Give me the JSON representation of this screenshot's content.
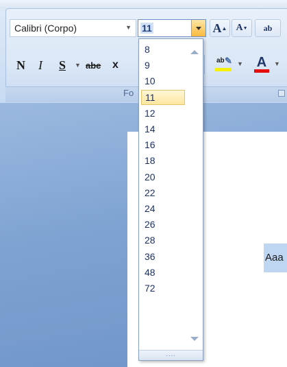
{
  "ribbon": {
    "font_name": "Calibri (Corpo)",
    "font_size": "11",
    "grow_font_label": "A",
    "shrink_font_label": "A",
    "clear_format_label": "ab",
    "bold_label": "N",
    "italic_label": "I",
    "underline_label": "S",
    "strikethrough_label": "abe",
    "subscript_label": "x",
    "highlight_label": "ab",
    "font_color_label": "A",
    "group_caption": "Fo",
    "highlight_color": "#f5f10a",
    "font_color": "#e50d0d"
  },
  "font_size_list": {
    "items": [
      "8",
      "9",
      "10",
      "11",
      "12",
      "14",
      "16",
      "18",
      "20",
      "22",
      "24",
      "26",
      "28",
      "36",
      "48",
      "72"
    ],
    "selected": "11",
    "grip": "...."
  },
  "document": {
    "style_preview": "Aaa"
  }
}
